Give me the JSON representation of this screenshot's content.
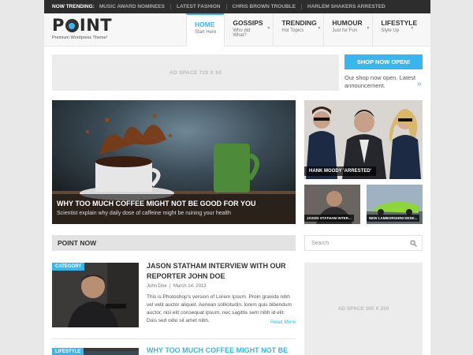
{
  "topbar": {
    "label": "Now Trending:",
    "items": [
      "Music Award Nominees",
      "Latest Fashion",
      "Chris Brown Trouble",
      "Harlem Shakers Arrested"
    ]
  },
  "logo": {
    "text_p": "P",
    "text_rest": "INT",
    "tagline": "Premium Wordpress Theme!"
  },
  "nav": [
    {
      "title": "Home",
      "sub": "Start Here"
    },
    {
      "title": "Gossips",
      "sub": "Who did What?"
    },
    {
      "title": "Trending",
      "sub": "Hot Topics"
    },
    {
      "title": "Humour",
      "sub": "Just for Fun"
    },
    {
      "title": "Lifestyle",
      "sub": "Style Up"
    }
  ],
  "ad_top": "AD SPACE 728 X 90",
  "shop": {
    "button": "SHOP NOW OPEN!",
    "text": "Our shop now open.  Latest announcement.",
    "arrow": "»"
  },
  "featured": {
    "title": "Why too much coffee might not be good for you",
    "subtitle": "Scientist explain why daily dose of caffeine might be ruining your health"
  },
  "featured_right": {
    "caption": "Hank Moody 'Arrested'"
  },
  "thumbs": [
    {
      "caption": "Jason Statham Inter..."
    },
    {
      "caption": "New Lamborghini Dese..."
    }
  ],
  "section_title": "Point Now",
  "search_placeholder": "Search",
  "ad_side": "AD SPACE 300 X 250",
  "articles": [
    {
      "category": "Category",
      "title": "Jason Statham interview with our reporter John Doe",
      "author": "John Doe",
      "date": "March 14, 2013",
      "excerpt": "This is Photoshop's version  of Lorem Ipsum. Proin gravida nibh vel velit auctor aliquet. Aenean sollicitudin, lorem quis bibendum auctor, nisi elit consequat ipsum, nec sagittis sem nibh id elit. Duis sed odio sit amet nibh.",
      "read_more": "Read More"
    },
    {
      "category": "Lifestyle",
      "title": "Why too much coffee might not be"
    }
  ],
  "colors": {
    "accent": "#38b7ee",
    "dark": "#2d2d2d"
  }
}
